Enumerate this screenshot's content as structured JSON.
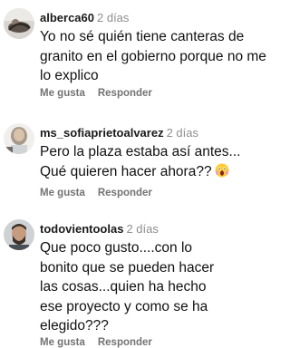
{
  "comments": [
    {
      "username": "alberca60",
      "time": "2 días",
      "text": "Yo no sé quién tiene canteras de granito en el gobierno porque no me lo explico",
      "avatar_icon": "profile-photo",
      "actions": {
        "like_label": "Me gusta",
        "reply_label": "Responder"
      }
    },
    {
      "username": "ms_sofiaprietoalvarez",
      "time": "2 días",
      "text": "Pero la plaza estaba así antes... Qué quieren hacer ahora??",
      "emoji": "screaming-face-emoji",
      "avatar_icon": "profile-photo",
      "actions": {
        "like_label": "Me gusta",
        "reply_label": "Responder"
      }
    },
    {
      "username": "todovientoolas",
      "time": "2 días",
      "text": "Que poco gusto....con lo bonito que se pueden hacer las cosas...quien ha hecho ese proyecto y como se ha elegido???",
      "avatar_icon": "profile-photo",
      "actions": {
        "like_label": "Me gusta",
        "reply_label": "Responder"
      }
    }
  ]
}
